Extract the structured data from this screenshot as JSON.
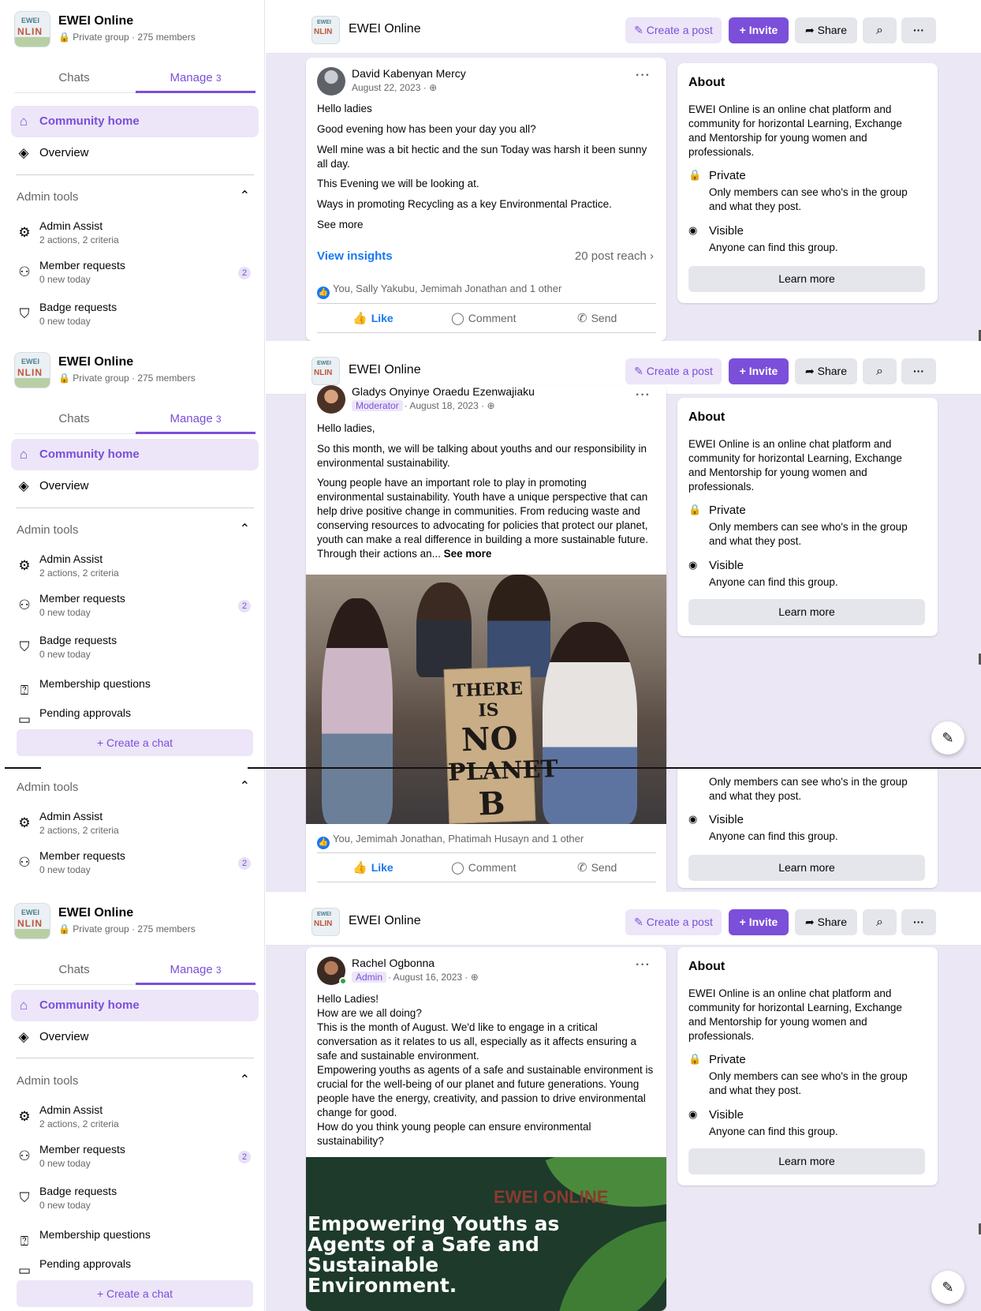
{
  "group": {
    "name": "EWEI Online",
    "meta": "Private group · 275 members",
    "logo_top": "EWEI",
    "logo_mid": "NLIN"
  },
  "tabs": {
    "chats": "Chats",
    "manage": "Manage",
    "manage_count": "3"
  },
  "nav": {
    "community_home": "Community home",
    "overview": "Overview"
  },
  "admin_tools": {
    "title": "Admin tools",
    "items": [
      {
        "title": "Admin Assist",
        "sub": "2 actions, 2 criteria",
        "icon": "gear-icon"
      },
      {
        "title": "Member requests",
        "sub": "0 new today",
        "badge": "2",
        "icon": "add-person-icon"
      },
      {
        "title": "Badge requests",
        "sub": "0 new today",
        "icon": "badge-icon"
      },
      {
        "title": "Membership questions",
        "icon": "question-icon"
      },
      {
        "title": "Pending approvals",
        "icon": "pending-icon"
      }
    ]
  },
  "create_chat": "+ Create a chat",
  "topbar": {
    "title": "EWEI Online",
    "create_post": "Create a post",
    "invite": "+ Invite",
    "share": "Share",
    "more": "···"
  },
  "about": {
    "title": "About",
    "description": "EWEI Online is an online chat platform and community for horizontal Learning, Exchange and Mentorship for young women and professionals.",
    "private_title": "Private",
    "private_desc": "Only members can see who's in the group and what they post.",
    "visible_title": "Visible",
    "visible_desc": "Anyone can find this group.",
    "learn_more": "Learn more"
  },
  "posts": [
    {
      "author": "David Kabenyan Mercy",
      "date": "August 22, 2023 · ⊕",
      "paragraphs": [
        "Hello ladies",
        "Good evening how has been your day you all?",
        "Well mine was a bit hectic and the sun Today was harsh it been sunny all day.",
        "This Evening we will be looking at.",
        "Ways in promoting Recycling as a key Environmental Practice.",
        "See more"
      ],
      "view_insights": "View insights",
      "reach": "20 post reach",
      "reactions": "You, Sally Yakubu, Jemimah Jonathan and 1 other"
    },
    {
      "author": "Gladys Onyinye Oraedu Ezenwajiaku",
      "role": "Moderator",
      "date": "· August 18, 2023 · ⊕",
      "paragraphs": [
        "Hello ladies,",
        "So this month, we will be talking about youths and our responsibility in environmental sustainability.",
        "Young people have an important role to play in promoting environmental sustainability. Youth have a unique perspective that can help drive positive change in communities. From reducing waste and conserving resources to advocating for policies that protect our planet, youth can make a real difference in building a more sustainable future. Through their actions an..."
      ],
      "see_more": "See more",
      "sign_text": [
        "THERE IS",
        "NO",
        "PLANET",
        "B"
      ],
      "reactions": "You, Jemimah Jonathan, Phatimah Husayn and 1 other"
    },
    {
      "author": "Rachel Ogbonna",
      "role": "Admin",
      "date": "· August 16, 2023 · ⊕",
      "text": "Hello Ladies!\nHow are we all doing?\nThis is the month of August. We'd like to engage in a critical conversation as it relates to us all, especially as it affects ensuring a safe and sustainable environment.\nEmpowering youths as agents of a safe and sustainable environment is crucial for the well-being of our planet and future generations. Young people have the energy, creativity, and passion to drive environmental change for good.\nHow do you think young people can ensure environmental sustainability?",
      "banner_brand": "EWEI ONLINE",
      "banner_headline": "Empowering Youths as Agents of a Safe and Sustainable Environment."
    }
  ],
  "actions": {
    "like": "Like",
    "comment": "Comment",
    "send": "Send"
  }
}
